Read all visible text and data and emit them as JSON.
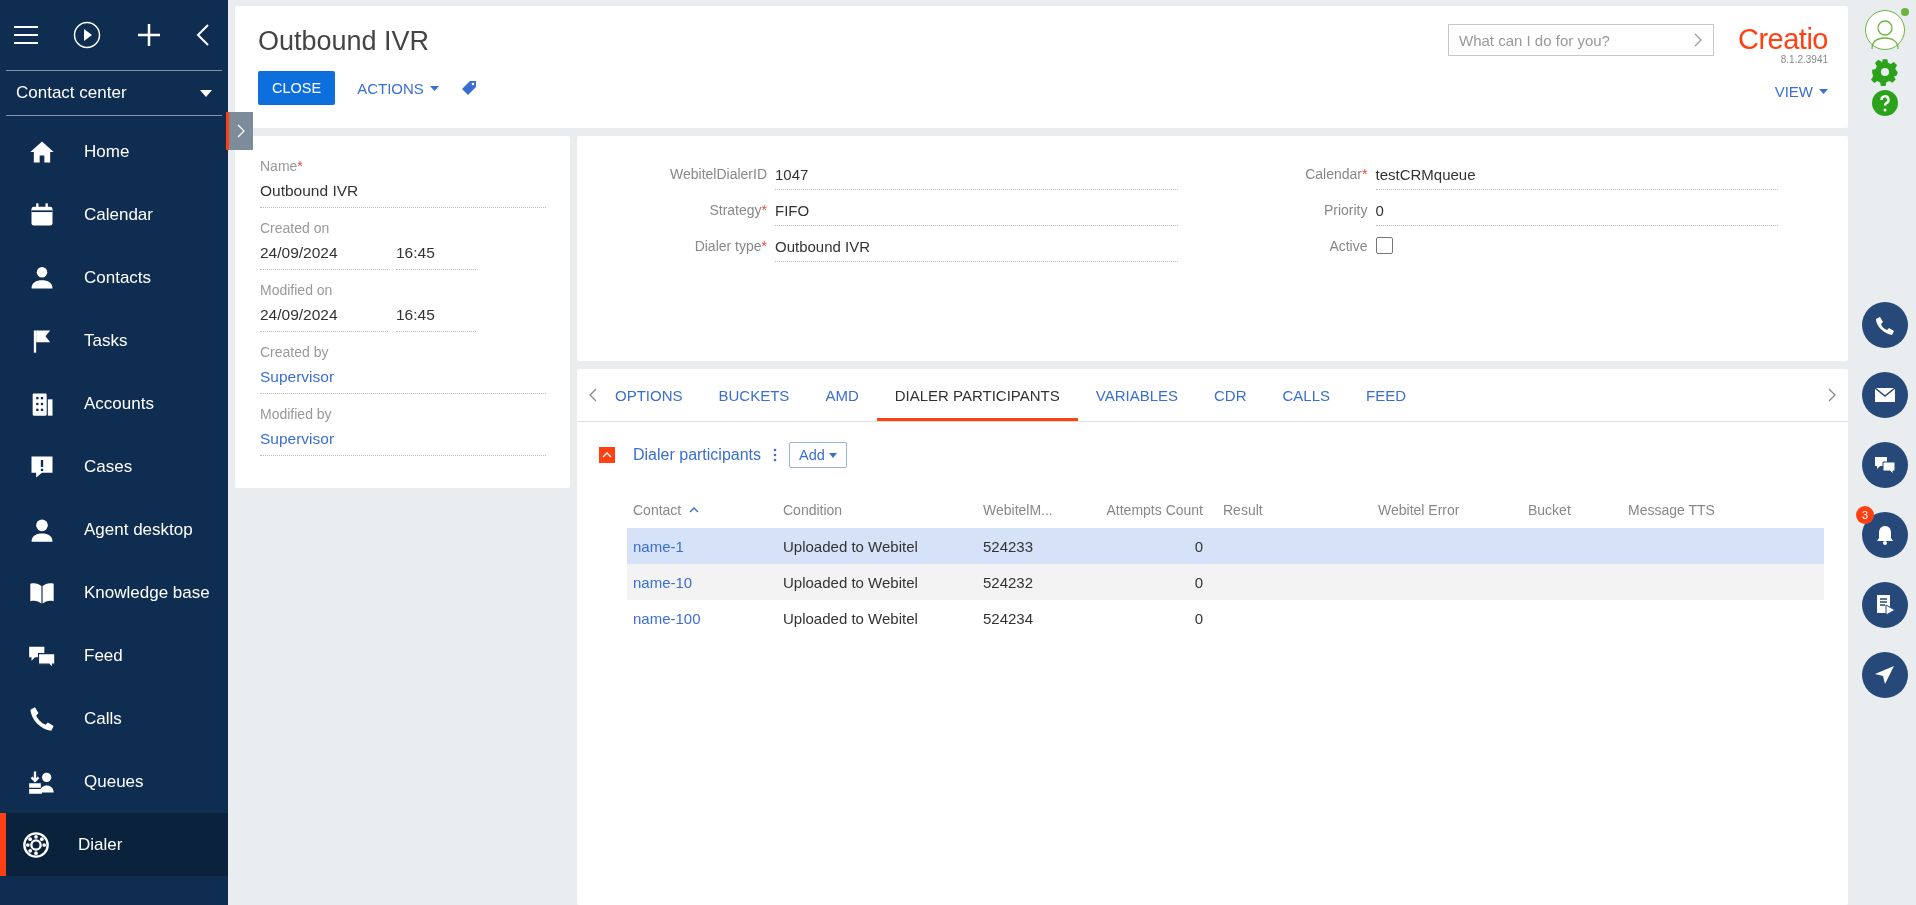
{
  "sidebar": {
    "section": "Contact center",
    "items": [
      {
        "label": "Home",
        "selected": false
      },
      {
        "label": "Calendar",
        "selected": false
      },
      {
        "label": "Contacts",
        "selected": false
      },
      {
        "label": "Tasks",
        "selected": false
      },
      {
        "label": "Accounts",
        "selected": false
      },
      {
        "label": "Cases",
        "selected": false
      },
      {
        "label": "Agent desktop",
        "selected": false
      },
      {
        "label": "Knowledge base",
        "selected": false
      },
      {
        "label": "Feed",
        "selected": false
      },
      {
        "label": "Calls",
        "selected": false
      },
      {
        "label": "Queues",
        "selected": false
      },
      {
        "label": "Dialer",
        "selected": true
      }
    ]
  },
  "header": {
    "title": "Outbound IVR",
    "close": "CLOSE",
    "actions": "ACTIONS",
    "search_placeholder": "What can I do for you?",
    "logo": "Creatio",
    "version": "8.1.2.3941",
    "view": "VIEW"
  },
  "profile": {
    "fields": [
      {
        "kind": "text",
        "label": "Name",
        "required_mark": "*",
        "value": "Outbound IVR"
      },
      {
        "kind": "datetime",
        "label": "Created on",
        "date": "24/09/2024",
        "time": "16:45"
      },
      {
        "kind": "datetime",
        "label": "Modified on",
        "date": "24/09/2024",
        "time": "16:45"
      },
      {
        "kind": "link",
        "label": "Created by",
        "value": "Supervisor"
      },
      {
        "kind": "link",
        "label": "Modified by",
        "value": "Supervisor"
      }
    ]
  },
  "details": {
    "left": [
      {
        "kind": "text",
        "label": "WebitelDialerID",
        "value": "1047"
      },
      {
        "kind": "text",
        "label": "Strategy",
        "required_mark": "*",
        "value": "FIFO"
      },
      {
        "kind": "text",
        "label": "Dialer type",
        "required_mark": "*",
        "value": "Outbound IVR"
      }
    ],
    "right": [
      {
        "kind": "text",
        "label": "Calendar",
        "required_mark": "*",
        "value": "testCRMqueue"
      },
      {
        "kind": "text",
        "label": "Priority",
        "value": "0"
      },
      {
        "kind": "checkbox",
        "label": "Active",
        "checked": false
      }
    ]
  },
  "tabs": [
    {
      "label": "OPTIONS",
      "selected": false
    },
    {
      "label": "BUCKETS",
      "selected": false
    },
    {
      "label": "AMD",
      "selected": false
    },
    {
      "label": "DIALER PARTICIPANTS",
      "selected": true
    },
    {
      "label": "VARIABLES",
      "selected": false
    },
    {
      "label": "CDR",
      "selected": false
    },
    {
      "label": "CALLS",
      "selected": false
    },
    {
      "label": "FEED",
      "selected": false
    }
  ],
  "participants": {
    "title": "Dialer participants",
    "expanded": true,
    "add": "Add",
    "columns": [
      {
        "label": "Contact",
        "sorted": true
      },
      {
        "label": "Condition",
        "sorted": false
      },
      {
        "label": "WebitelM...",
        "sorted": false
      },
      {
        "label": "Attempts Count",
        "sorted": false
      },
      {
        "label": "Result",
        "sorted": false
      },
      {
        "label": "Webitel Error",
        "sorted": false
      },
      {
        "label": "Bucket",
        "sorted": false
      },
      {
        "label": "Message TTS",
        "sorted": false
      }
    ],
    "rows": [
      {
        "selected": true,
        "cells": [
          "name-1",
          "Uploaded to Webitel",
          "524233",
          "0"
        ]
      },
      {
        "selected": false,
        "cells": [
          "name-10",
          "Uploaded to Webitel",
          "524232",
          "0"
        ]
      },
      {
        "selected": false,
        "cells": [
          "name-100",
          "Uploaded to Webitel",
          "524234",
          "0"
        ]
      }
    ]
  },
  "notifications": {
    "badge": "3"
  }
}
